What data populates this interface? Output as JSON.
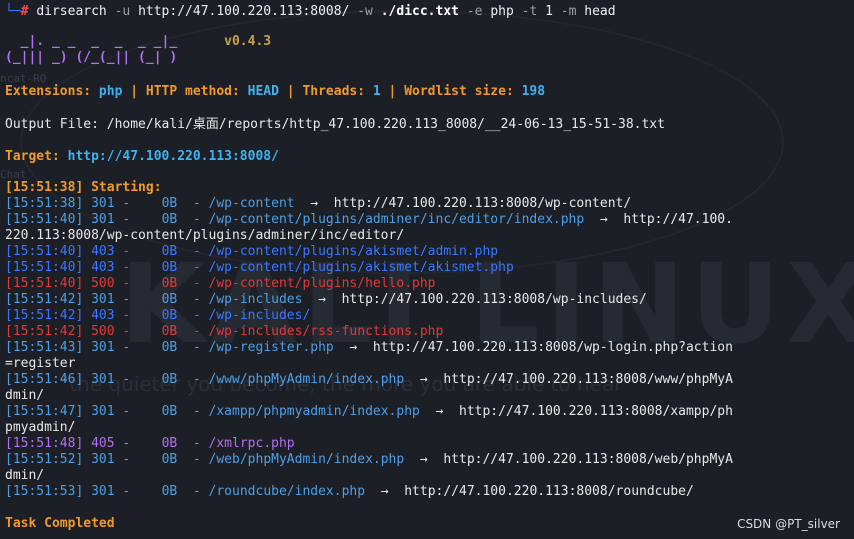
{
  "command": {
    "prompt_corner": "└─",
    "prompt_symbol": "#",
    "program": "dirsearch",
    "flag_u": "-u",
    "url": "http://47.100.220.113:8008/",
    "flag_w": "-w",
    "wordlist": "./dicc.txt",
    "flag_e": "-e",
    "ext": "php",
    "flag_t": "-t",
    "threads": "1",
    "flag_m": "-m",
    "method": "head"
  },
  "banner": {
    "art_line1": "  _|. _ _  _  _  _ _|_",
    "art_line2": "(_||| _) (/_(_|| (_| )",
    "version": "v0.4.3"
  },
  "config": {
    "ext_label": "Extensions:",
    "ext_value": "php",
    "method_label": "HTTP method:",
    "method_value": "HEAD",
    "threads_label": "Threads:",
    "threads_value": "1",
    "wordlist_label": "Wordlist size:",
    "wordlist_value": "198",
    "separator": "|"
  },
  "output_file": "Output File: /home/kali/桌面/reports/http_47.100.220.113_8008/__24-06-13_15-51-38.txt",
  "target": {
    "label": "Target:",
    "value": "http://47.100.220.113:8008/"
  },
  "starting": "[15:51:38] Starting:",
  "results": [
    {
      "time": "[15:51:38]",
      "status": "301",
      "size": "0B",
      "path": "/wp-content",
      "redirect": "http://47.100.220.113:8008/wp-content/",
      "cont": ""
    },
    {
      "time": "[15:51:40]",
      "status": "301",
      "size": "0B",
      "path": "/wp-content/plugins/adminer/inc/editor/index.php",
      "redirect": "http://47.100.",
      "cont": "220.113:8008/wp-content/plugins/adminer/inc/editor/"
    },
    {
      "time": "[15:51:40]",
      "status": "403",
      "size": "0B",
      "path": "/wp-content/plugins/akismet/admin.php",
      "redirect": "",
      "cont": ""
    },
    {
      "time": "[15:51:40]",
      "status": "403",
      "size": "0B",
      "path": "/wp-content/plugins/akismet/akismet.php",
      "redirect": "",
      "cont": ""
    },
    {
      "time": "[15:51:40]",
      "status": "500",
      "size": "0B",
      "path": "/wp-content/plugins/hello.php",
      "redirect": "",
      "cont": ""
    },
    {
      "time": "[15:51:42]",
      "status": "301",
      "size": "0B",
      "path": "/wp-includes",
      "redirect": "http://47.100.220.113:8008/wp-includes/",
      "cont": ""
    },
    {
      "time": "[15:51:42]",
      "status": "403",
      "size": "0B",
      "path": "/wp-includes/",
      "redirect": "",
      "cont": ""
    },
    {
      "time": "[15:51:42]",
      "status": "500",
      "size": "0B",
      "path": "/wp-includes/rss-functions.php",
      "redirect": "",
      "cont": ""
    },
    {
      "time": "[15:51:43]",
      "status": "301",
      "size": "0B",
      "path": "/wp-register.php",
      "redirect": "http://47.100.220.113:8008/wp-login.php?action",
      "cont": "=register"
    },
    {
      "time": "[15:51:46]",
      "status": "301",
      "size": "0B",
      "path": "/www/phpMyAdmin/index.php",
      "redirect": "http://47.100.220.113:8008/www/phpMyA",
      "cont": "dmin/"
    },
    {
      "time": "[15:51:47]",
      "status": "301",
      "size": "0B",
      "path": "/xampp/phpmyadmin/index.php",
      "redirect": "http://47.100.220.113:8008/xampp/ph",
      "cont": "pmyadmin/"
    },
    {
      "time": "[15:51:48]",
      "status": "405",
      "size": "0B",
      "path": "/xmlrpc.php",
      "redirect": "",
      "cont": ""
    },
    {
      "time": "[15:51:52]",
      "status": "301",
      "size": "0B",
      "path": "/web/phpMyAdmin/index.php",
      "redirect": "http://47.100.220.113:8008/web/phpMyA",
      "cont": "dmin/"
    },
    {
      "time": "[15:51:53]",
      "status": "301",
      "size": "0B",
      "path": "/roundcube/index.php",
      "redirect": "http://47.100.220.113:8008/roundcube/",
      "cont": ""
    }
  ],
  "arrow": "→",
  "dash": "-",
  "task_completed": "Task Completed",
  "watermark": "CSDN @PT_silver",
  "colors": {
    "background": "#1c1f26",
    "orange": "#f19a2c",
    "cyan": "#3fb3f2",
    "purple": "#b46ff2",
    "red": "#e03a3a",
    "blue": "#3a78ff"
  }
}
